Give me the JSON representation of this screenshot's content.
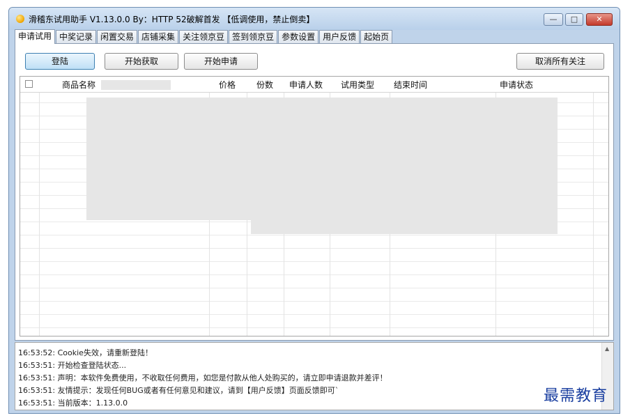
{
  "window": {
    "title": "滑稽东试用助手 V1.13.0.0  By：HTTP 52破解首发 【低调使用，禁止倒卖】",
    "controls": {
      "minimize": "—",
      "maximize": "□",
      "close": "✕"
    }
  },
  "tabs": [
    "申请试用",
    "中奖记录",
    "闲置交易",
    "店铺采集",
    "关注领京豆",
    "签到领京豆",
    "参数设置",
    "用户反馈",
    "起始页"
  ],
  "toolbar": {
    "login": "登陆",
    "start_fetch": "开始获取",
    "start_apply": "开始申请",
    "unfollow_all": "取消所有关注"
  },
  "table": {
    "columns": [
      "商品名称",
      "价格",
      "份数",
      "申请人数",
      "试用类型",
      "结束时间",
      "申请状态"
    ],
    "rows": []
  },
  "log": [
    "16:53:52: Cookie失效，请重新登陆！",
    "16:53:51: 开始检查登陆状态...",
    "16:53:51: 声明：本软件免费使用，不收取任何费用，如您是付款从他人处购买的，请立即申请退款并差评！",
    "16:53:51: 友情提示：发现任何BUG或者有任何意见和建议，请到【用户反馈】页面反馈即可`",
    "16:53:51: 当前版本：1.13.0.0"
  ],
  "watermark": "最需教育",
  "colors": {
    "accent_button": "#bfe0f6",
    "close_button": "#c3392b",
    "title_bar": "#c8dbf0"
  }
}
